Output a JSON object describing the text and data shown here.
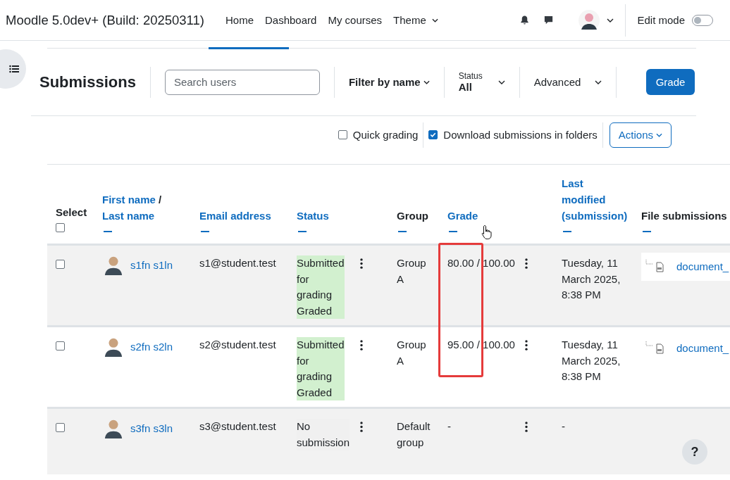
{
  "site_title": "Moodle 5.0dev+ (Build: 20250311)",
  "nav": [
    {
      "label": "Home",
      "dropdown": false
    },
    {
      "label": "Dashboard",
      "dropdown": false
    },
    {
      "label": "My courses",
      "dropdown": false
    },
    {
      "label": "Theme",
      "dropdown": true
    }
  ],
  "edit_mode": {
    "label": "Edit mode",
    "on": false
  },
  "page_title": "Submissions",
  "search": {
    "placeholder": "Search users"
  },
  "filters": [
    {
      "kind": "menu",
      "label": "Filter by name"
    },
    {
      "kind": "select",
      "caption": "Status",
      "value": "All"
    },
    {
      "kind": "plain",
      "label": "Advanced"
    }
  ],
  "grade_button": "Grade",
  "options": [
    {
      "label": "Quick grading",
      "checked": false
    },
    {
      "label": "Download submissions in folders",
      "checked": true
    }
  ],
  "actions_button": "Actions",
  "table": {
    "select_all_checked": false,
    "columns": [
      {
        "kind": "select",
        "label": "Select"
      },
      {
        "kind": "name",
        "first": "First name",
        "separator": "/",
        "last": "Last name"
      },
      {
        "kind": "link",
        "label": "Email address"
      },
      {
        "kind": "link",
        "label": "Status"
      },
      {
        "kind": "plain",
        "label": "Group"
      },
      {
        "kind": "link",
        "label": "Grade"
      },
      {
        "kind": "link",
        "label": "Last modified (submission)"
      },
      {
        "kind": "plain",
        "label": "File submissions"
      }
    ],
    "rows": [
      {
        "checked": false,
        "name": "s1fn s1ln",
        "email": "s1@student.test",
        "status": "Submitted for grading",
        "grading_status": "Graded",
        "submitted": true,
        "group": "Group A",
        "grade": "80.00 / 100.00",
        "modified": "Tuesday, 11 March 2025, 8:38 PM",
        "file": "document_"
      },
      {
        "checked": false,
        "name": "s2fn s2ln",
        "email": "s2@student.test",
        "status": "Submitted for grading",
        "grading_status": "Graded",
        "submitted": true,
        "group": "Group A",
        "grade": "95.00 / 100.00",
        "modified": "Tuesday, 11 March 2025, 8:38 PM",
        "file": "document_"
      },
      {
        "checked": false,
        "name": "s3fn s3ln",
        "email": "s3@student.test",
        "status": "No submission",
        "submitted": false,
        "group": "Default group",
        "grade": "-",
        "modified": "-"
      }
    ]
  },
  "help_button": "?"
}
